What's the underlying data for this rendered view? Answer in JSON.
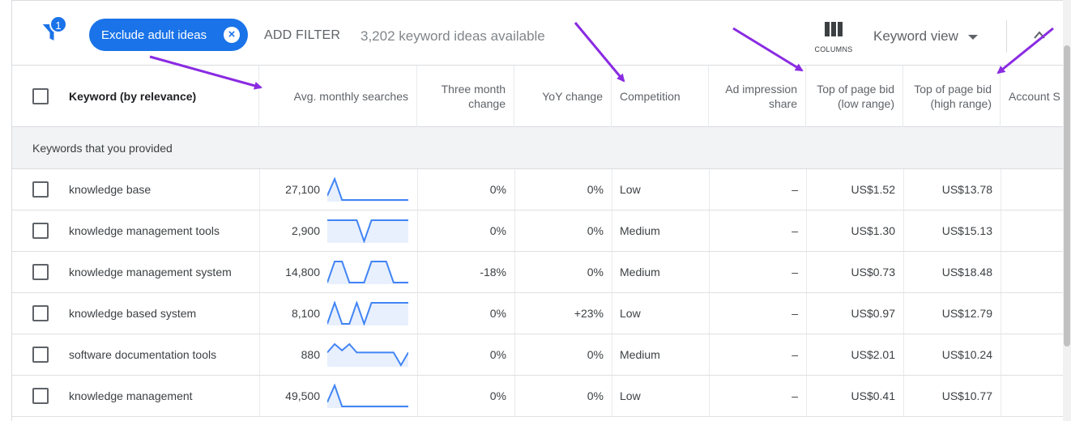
{
  "toolbar": {
    "filter_count": "1",
    "chip_label": "Exclude adult ideas",
    "add_filter_label": "ADD FILTER",
    "ideas_available": "3,202 keyword ideas available",
    "columns_label": "COLUMNS",
    "keyword_view_label": "Keyword view"
  },
  "table": {
    "headers": {
      "keyword": "Keyword (by relevance)",
      "avg_searches": "Avg. monthly searches",
      "three_month": "Three month change",
      "yoy": "YoY change",
      "competition": "Competition",
      "ad_impression": "Ad impression share",
      "bid_low": "Top of page bid (low range)",
      "bid_high": "Top of page bid (high range)",
      "account": "Account S"
    },
    "section_label": "Keywords that you provided",
    "rows": [
      {
        "keyword": "knowledge base",
        "searches": "27,100",
        "trend": [
          0.2,
          1.0,
          0.0,
          0.0,
          0.0,
          0.0,
          0.0,
          0.0,
          0.0,
          0.0,
          0.0,
          0.0
        ],
        "three_month": "0%",
        "yoy": "0%",
        "competition": "Low",
        "ad_share": "–",
        "bid_low": "US$1.52",
        "bid_high": "US$13.78"
      },
      {
        "keyword": "knowledge management tools",
        "searches": "2,900",
        "trend": [
          1.0,
          1.0,
          1.0,
          1.0,
          1.0,
          0.0,
          1.0,
          1.0,
          1.0,
          1.0,
          1.0,
          1.0
        ],
        "three_month": "0%",
        "yoy": "0%",
        "competition": "Medium",
        "ad_share": "–",
        "bid_low": "US$1.30",
        "bid_high": "US$15.13"
      },
      {
        "keyword": "knowledge management system",
        "searches": "14,800",
        "trend": [
          0.0,
          1.0,
          1.0,
          0.0,
          0.0,
          0.0,
          1.0,
          1.0,
          1.0,
          0.0,
          0.0,
          0.0
        ],
        "three_month": "-18%",
        "yoy": "0%",
        "competition": "Medium",
        "ad_share": "–",
        "bid_low": "US$0.73",
        "bid_high": "US$18.48"
      },
      {
        "keyword": "knowledge based system",
        "searches": "8,100",
        "trend": [
          0.0,
          1.0,
          0.0,
          0.0,
          1.0,
          0.0,
          1.0,
          1.0,
          1.0,
          1.0,
          1.0,
          1.0
        ],
        "three_month": "0%",
        "yoy": "+23%",
        "competition": "Low",
        "ad_share": "–",
        "bid_low": "US$0.97",
        "bid_high": "US$12.79"
      },
      {
        "keyword": "software documentation tools",
        "searches": "880",
        "trend": [
          0.6,
          1.0,
          0.7,
          1.0,
          0.6,
          0.6,
          0.6,
          0.6,
          0.6,
          0.6,
          0.0,
          0.6
        ],
        "three_month": "0%",
        "yoy": "0%",
        "competition": "Medium",
        "ad_share": "–",
        "bid_low": "US$2.01",
        "bid_high": "US$10.24"
      },
      {
        "keyword": "knowledge management",
        "searches": "49,500",
        "trend": [
          0.2,
          1.0,
          0.0,
          0.0,
          0.0,
          0.0,
          0.0,
          0.0,
          0.0,
          0.0,
          0.0,
          0.0
        ],
        "three_month": "0%",
        "yoy": "0%",
        "competition": "Low",
        "ad_share": "–",
        "bid_low": "US$0.41",
        "bid_high": "US$10.77"
      }
    ]
  },
  "colors": {
    "accent": "#1a73e8",
    "sparkline": "#4285f4",
    "sparkline_fill": "#e8f0fe",
    "annotation_arrow": "#8a2be2"
  },
  "icons": {
    "filter": "filter-icon",
    "chip_close": "close-circle-icon",
    "columns": "columns-icon",
    "dropdown": "caret-down-icon",
    "collapse": "chevron-up-icon"
  }
}
